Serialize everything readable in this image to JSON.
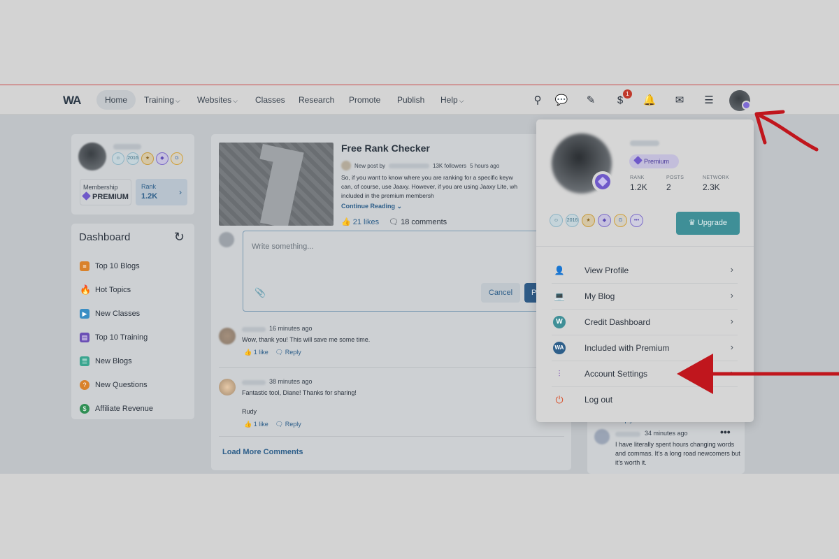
{
  "nav": {
    "logo": "WA",
    "items": [
      {
        "label": "Home",
        "caret": false
      },
      {
        "label": "Training",
        "caret": true
      },
      {
        "label": "Websites",
        "caret": true
      },
      {
        "label": "Classes",
        "caret": false
      },
      {
        "label": "Research",
        "caret": false
      },
      {
        "label": "Promote",
        "caret": false
      },
      {
        "label": "Publish",
        "caret": false
      },
      {
        "label": "Help",
        "caret": true
      }
    ],
    "money_badge": "1"
  },
  "profile_card": {
    "badges": [
      "2016",
      "G"
    ],
    "membership_label": "Membership",
    "membership_value": "PREMIUM",
    "rank_label": "Rank",
    "rank_value": "1.2K"
  },
  "dashboard": {
    "title": "Dashboard",
    "items": [
      {
        "label": "Top 10 Blogs",
        "color": "#d9822b"
      },
      {
        "label": "Hot Topics",
        "color": "#d4552b"
      },
      {
        "label": "New Classes",
        "color": "#3a8ec4"
      },
      {
        "label": "Top 10 Training",
        "color": "#6b4fb5"
      },
      {
        "label": "New Blogs",
        "color": "#3aa58f"
      },
      {
        "label": "New Questions",
        "color": "#d9822b"
      },
      {
        "label": "Affiliate Revenue",
        "color": "#2f8f54"
      }
    ]
  },
  "post": {
    "title": "Free Rank Checker",
    "new_post_by": "New post by",
    "followers": "13K followers",
    "time": "5 hours ago",
    "text_lines": [
      "So, if you want to know where you are ranking for a specific keyw",
      "can, of course, use Jaaxy. However, if you are using Jaaxy Lite, wh",
      "included in the premium membersh"
    ],
    "continue": "Continue Reading",
    "likes": "21 likes",
    "comments": "18 comments"
  },
  "composer": {
    "placeholder": "Write something...",
    "cancel": "Cancel",
    "post": "P"
  },
  "comments": [
    {
      "time": "16 minutes ago",
      "text": "Wow, thank you! This will save me some time.",
      "extra": "",
      "like": "1 like",
      "reply": "Reply"
    },
    {
      "time": "38 minutes ago",
      "text": "Fantastic tool, Diane! Thanks for sharing!",
      "extra": "Rudy",
      "like": "1 like",
      "reply": "Reply"
    }
  ],
  "load_more": "Load More Comments",
  "right_feed": {
    "reply": "Reply",
    "time": "34 minutes ago",
    "text": "I have literally spent hours changing words and commas. It's a long road newcomers but it's worth it."
  },
  "dropdown": {
    "premium": "Premium",
    "stats": [
      {
        "label": "RANK",
        "value": "1.2K"
      },
      {
        "label": "POSTS",
        "value": "2"
      },
      {
        "label": "NETWORK",
        "value": "2.3K"
      }
    ],
    "badges": [
      "2016",
      "G"
    ],
    "upgrade": "Upgrade",
    "menu": [
      {
        "label": "View Profile",
        "icon": "user-icon",
        "chev": true
      },
      {
        "label": "My Blog",
        "icon": "laptop-icon",
        "chev": true
      },
      {
        "label": "Credit Dashboard",
        "icon": "credit-icon",
        "chev": true
      },
      {
        "label": "Included with Premium",
        "icon": "wa-badge-icon",
        "chev": true
      },
      {
        "label": "Account Settings",
        "icon": "sliders-icon",
        "chev": true
      },
      {
        "label": "Log out",
        "icon": "power-icon",
        "chev": false
      }
    ]
  },
  "colors": {
    "accent": "#2e5f8a",
    "upgrade": "#3f8f97",
    "premium": "#6f59c9",
    "annotation": "#c0161d"
  }
}
